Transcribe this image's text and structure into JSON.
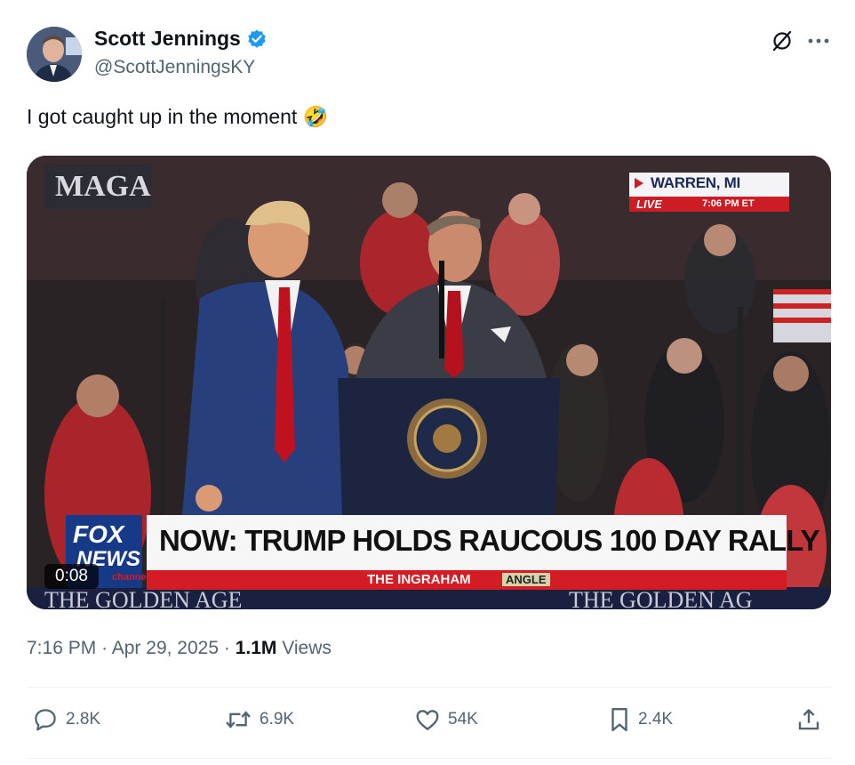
{
  "author": {
    "display_name": "Scott Jennings",
    "handle": "@ScottJenningsKY",
    "verified": true,
    "verified_color": "#1d9bf0"
  },
  "tweet": {
    "text": "I got caught up in the moment 🤣"
  },
  "video": {
    "duration": "0:08",
    "location": "WARREN, MI",
    "live_label": "LIVE",
    "live_time": "7:06 PM ET",
    "chyron": "NOW: TRUMP HOLDS RAUCOUS 100 DAY RALLY",
    "show_name": "THE INGRAHAM",
    "show_name_2": "ANGLE",
    "network_line1": "FOX",
    "network_line2": "NEWS",
    "network_line3": "channel"
  },
  "meta": {
    "time": "7:16 PM",
    "separator": "·",
    "date": "Apr 29, 2025",
    "views_count": "1.1M",
    "views_label": "Views"
  },
  "actions": {
    "replies": "2.8K",
    "reposts": "6.9K",
    "likes": "54K",
    "bookmarks": "2.4K"
  },
  "icons": [
    "grok-icon",
    "more-icon",
    "verified-badge-icon",
    "reply-icon",
    "repost-icon",
    "like-icon",
    "bookmark-icon",
    "share-icon"
  ]
}
